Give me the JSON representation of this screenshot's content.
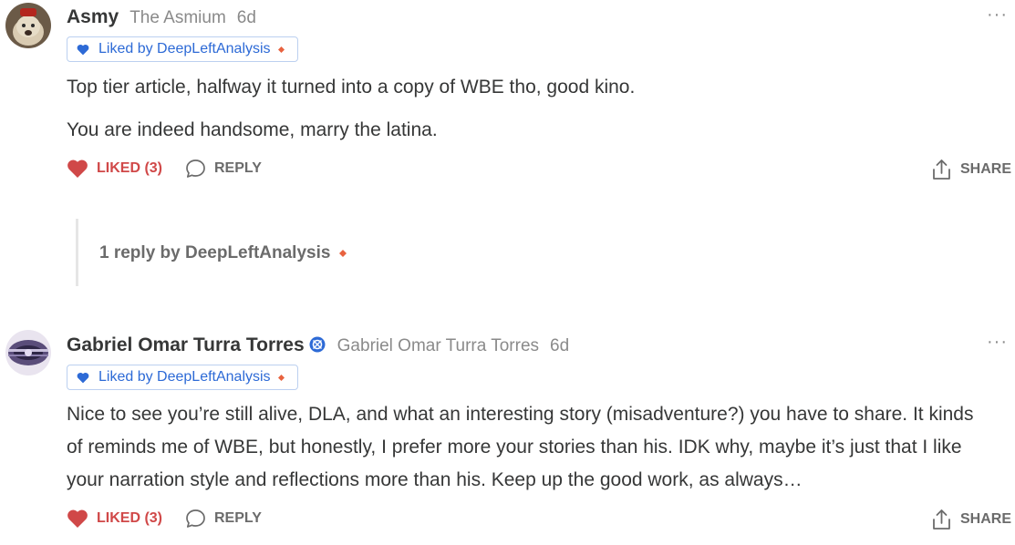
{
  "comments": [
    {
      "author": "Asmy",
      "publication": "The Asmium",
      "time": "6d",
      "more": "···",
      "liked_by": "Liked by DeepLeftAnalysis",
      "paragraphs": [
        "Top tier article, halfway it turned into a copy of WBE tho, good kino.",
        "You are indeed handsome, marry the latina."
      ],
      "like_label": "LIKED (3)",
      "reply_label": "REPLY",
      "share_label": "SHARE",
      "replies_summary": "1 reply by DeepLeftAnalysis"
    },
    {
      "author": "Gabriel Omar Turra Torres",
      "publication": "Gabriel Omar Turra Torres",
      "time": "6d",
      "more": "···",
      "liked_by": "Liked by DeepLeftAnalysis",
      "paragraphs": [
        "Nice to see you’re still alive, DLA, and what an interesting story (misadventure?) you have to share. It kinds of reminds me of WBE, but honestly, I prefer more your stories than his. IDK why, maybe it’s just that I like your narration style and reflections more than his. Keep up the good work, as always…"
      ],
      "like_label": "LIKED (3)",
      "reply_label": "REPLY",
      "share_label": "SHARE"
    }
  ],
  "colors": {
    "liked_red": "#d04848",
    "badge_blue": "#2d6ad6",
    "badge_border": "#bcd0f0",
    "diamond_orange": "#e8623f",
    "muted": "#8a8a8a"
  },
  "icons": [
    "heart-icon",
    "comment-bubble-icon",
    "share-icon",
    "more-options-icon",
    "verified-badge-icon",
    "diamond-icon"
  ]
}
